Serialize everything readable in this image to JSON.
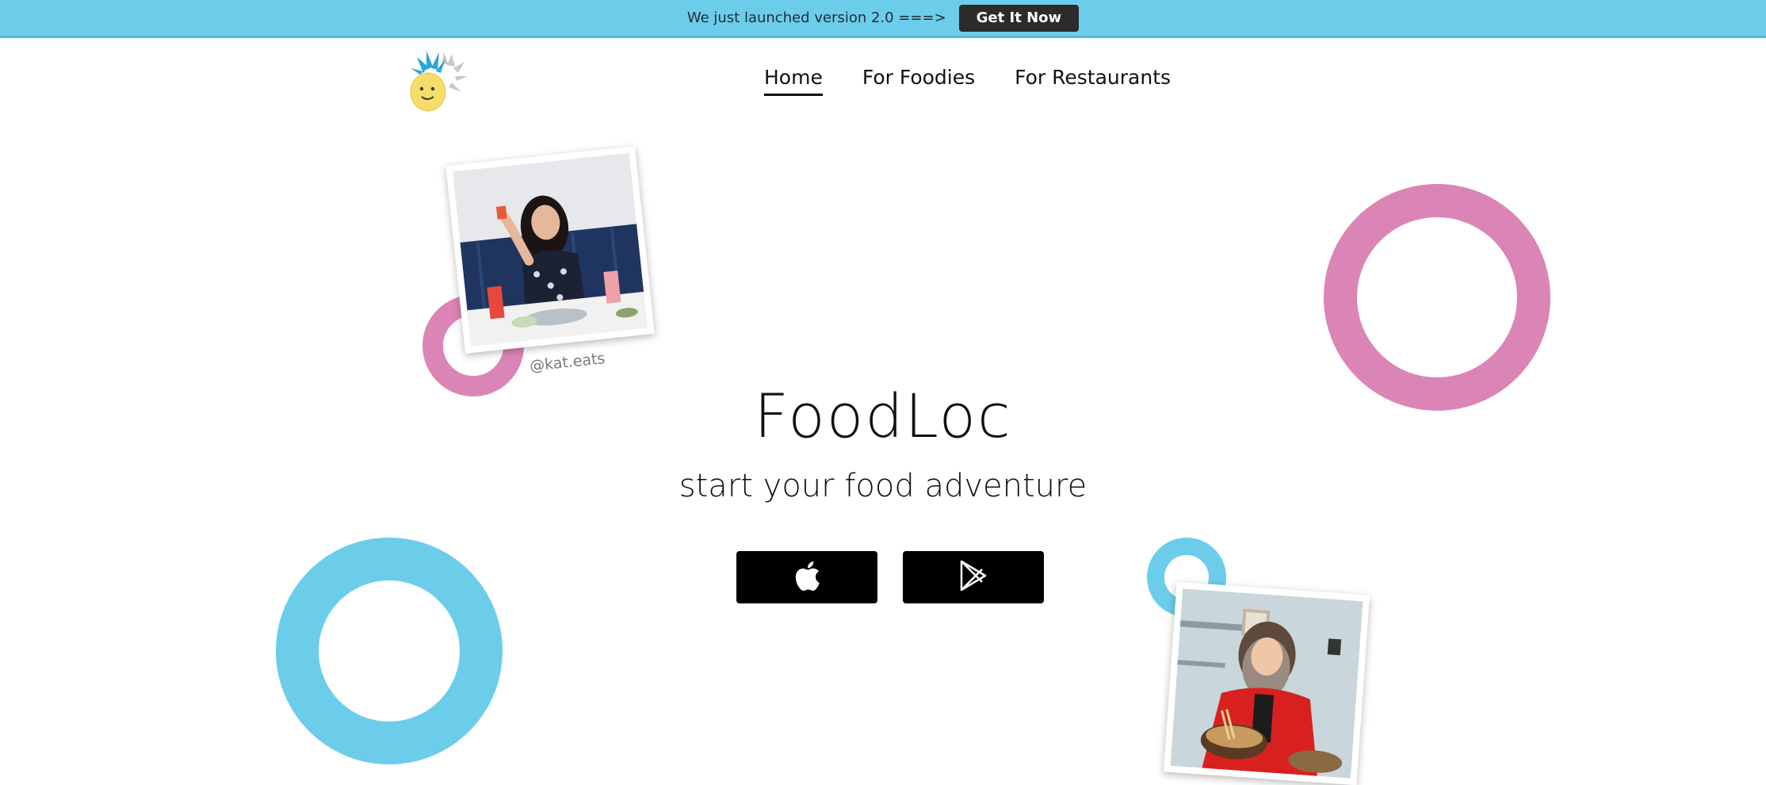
{
  "announcement": {
    "text": "We just launched version 2.0 ===>",
    "button_label": "Get It Now"
  },
  "nav": {
    "items": [
      {
        "label": "Home",
        "active": true
      },
      {
        "label": "For Foodies",
        "active": false
      },
      {
        "label": "For Restaurants",
        "active": false
      }
    ]
  },
  "hero": {
    "title": "FoodLoc",
    "subtitle": "start your food adventure",
    "photo_caption": "@kat.eats"
  },
  "store_buttons": [
    {
      "icon": "apple-icon"
    },
    {
      "icon": "google-play-icon"
    }
  ],
  "colors": {
    "banner": "#6ccdeb",
    "pink": "#db85b6",
    "blue": "#6ccdeb",
    "dark_button": "#2b2b2b"
  }
}
